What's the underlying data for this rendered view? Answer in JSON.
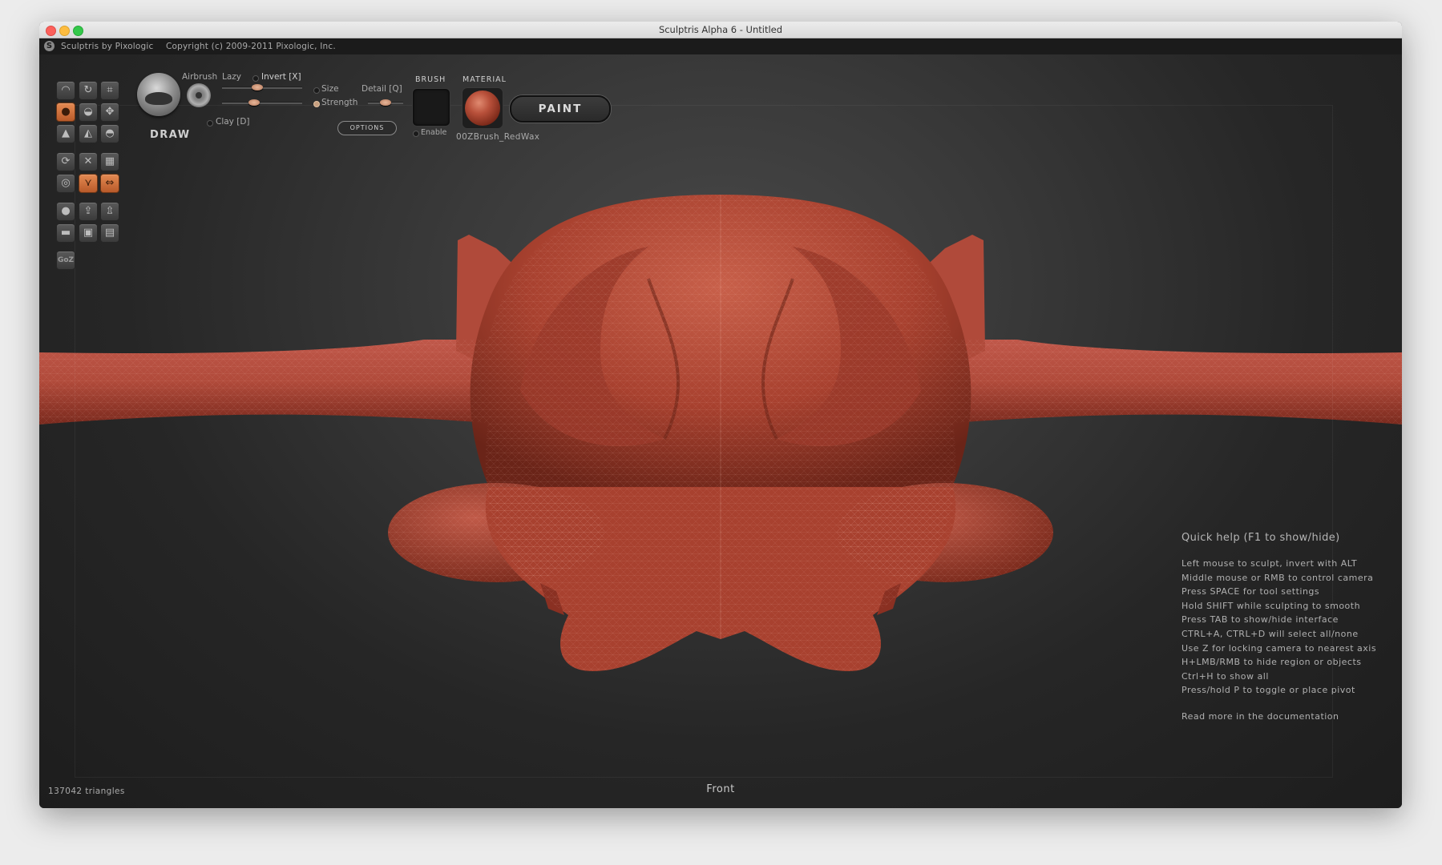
{
  "window": {
    "title": "Sculptris Alpha 6 - Untitled"
  },
  "topbar": {
    "app_name": "Sculptris by Pixologic",
    "copyright": "Copyright (c) 2009-2011 Pixologic, Inc."
  },
  "tools": {
    "group1": [
      "draw-tool",
      "rotate-tool",
      "crop-tool",
      "inflate-tool",
      "pinch-tool",
      "grab-tool",
      "flatten-tool",
      "crease-tool",
      "smooth-tool"
    ],
    "group2": [
      "scale-tool",
      "clear-symmetry",
      "reduce-brush",
      "wireframe-toggle",
      "symmetry-toggle",
      "mirror-toggle"
    ],
    "group3": [
      "sphere-new",
      "import-mesh",
      "export-mesh",
      "plane-new",
      "save-file",
      "load-file"
    ],
    "goz_label": "GoZ"
  },
  "brush": {
    "name": "DRAW",
    "airbrush_label": "Airbrush",
    "lazy_label": "Lazy",
    "invert_label": "Invert [X]",
    "size_label": "Size",
    "strength_label": "Strength",
    "detail_label": "Detail [Q]",
    "clay_label": "Clay [D]",
    "options_label": "OPTIONS",
    "size_value": 0.55,
    "strength_value": 0.45,
    "detail_value": 0.5
  },
  "brush_section": {
    "label": "BRUSH",
    "enable_label": "Enable"
  },
  "material_section": {
    "label": "MATERIAL",
    "material_name": "00ZBrush_RedWax"
  },
  "paint_button": {
    "label": "PAINT"
  },
  "quick_help": {
    "title": "Quick help (F1 to show/hide)",
    "lines": [
      "Left mouse to sculpt, invert with ALT",
      "Middle mouse or RMB to control camera",
      "Press SPACE for tool settings",
      "Hold SHIFT while sculpting to smooth",
      "Press TAB to show/hide interface",
      "CTRL+A, CTRL+D will select all/none",
      "Use Z for locking camera to nearest axis",
      "H+LMB/RMB to hide region or objects",
      "Ctrl+H to show all",
      "Press/hold P to toggle or place pivot"
    ],
    "more": "Read more in the documentation"
  },
  "status": {
    "triangles": "137042 triangles",
    "view": "Front"
  },
  "colors": {
    "mesh": "#b84a3a",
    "accent": "#d97a44",
    "background": "#2e2e2e"
  }
}
